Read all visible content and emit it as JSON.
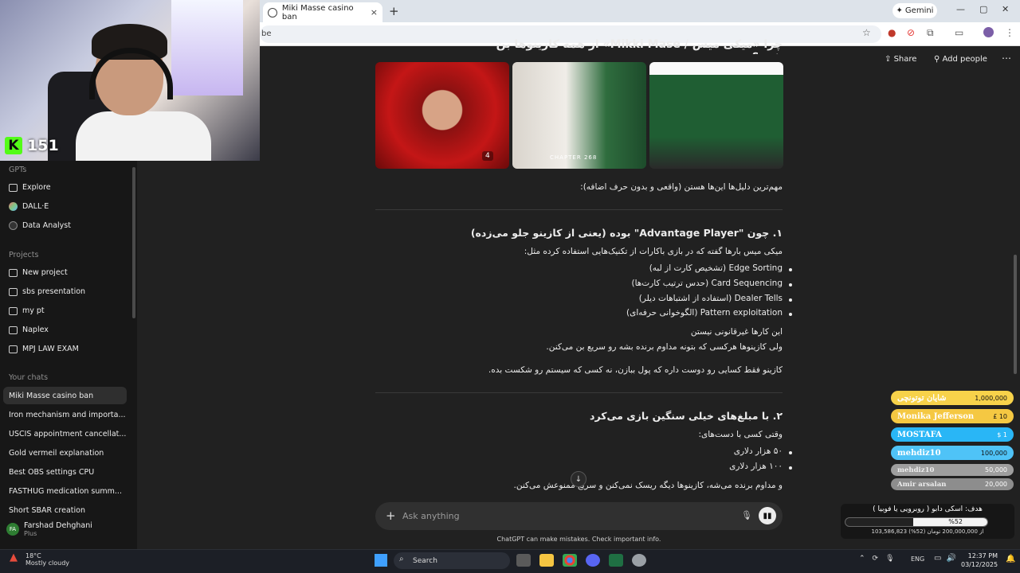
{
  "browser": {
    "tab_title": "Miki Masse casino ban",
    "tab_close": "×",
    "new_tab": "+",
    "gemini_label": "Gemini",
    "url_fragment": "be",
    "win_min": "—",
    "win_max": "▢",
    "win_close": "✕"
  },
  "stream": {
    "platform_badge": "K",
    "viewer_count": "151"
  },
  "sidebar": {
    "gpts_heading": "GPTs",
    "gpts": [
      {
        "label": "Explore",
        "icon": "grid-icon"
      },
      {
        "label": "DALL·E",
        "icon": "dalle-icon"
      },
      {
        "label": "Data Analyst",
        "icon": "data-analyst-icon"
      }
    ],
    "projects_heading": "Projects",
    "projects": [
      {
        "label": "New project"
      },
      {
        "label": "sbs presentation"
      },
      {
        "label": "my pt"
      },
      {
        "label": "Naplex"
      },
      {
        "label": "MPJ LAW EXAM"
      }
    ],
    "chats_heading": "Your chats",
    "chats": [
      "Miki Masse casino ban",
      "Iron mechanism and importa...",
      "USCIS appointment cancellat...",
      "Gold vermeil explanation",
      "Best OBS settings CPU",
      "FASTHUG medication summ...",
      "Short SBAR creation"
    ],
    "user": {
      "initials": "FA",
      "name": "Farshad Dehghani",
      "plan": "Plus"
    }
  },
  "header": {
    "share": "Share",
    "add_people": "Add people",
    "more": "⋯"
  },
  "content": {
    "top_heading": "چرا «میکی میس / Mikki Mase» از همه کازینوها بن شده؟",
    "image_count": "4",
    "chapter_text": "CHAPTER 268",
    "intro": "مهم‌ترین دلیل‌ها این‌ها هستن (واقعی و بدون حرف اضافه):",
    "section1_title": "۱. چون \"Advantage Player\" بوده (یعنی از کازینو جلو می‌زده)",
    "section1_lead": "میکی میس بارها گفته که در بازی باکارات از تکنیک‌هایی استفاده کرده مثل:",
    "section1_bullets": [
      "Edge Sorting (تشخیص کارت از لبه)",
      "Card Sequencing (حدس ترتیب کارت‌ها)",
      "Dealer Tells (استفاده از اشتباهات دیلر)",
      "Pattern exploitation (الگوخوانی حرفه‌ای)"
    ],
    "section1_p1": "این کارها غیرقانونی نیستن",
    "section1_p2": "ولی کازینوها هرکسی که بتونه مداوم برنده بشه رو سریع بن می‌کنن.",
    "section1_p3": "کازینو فقط کسایی رو دوست داره که پول ببازن، نه کسی که سیستم رو شکست بده.",
    "section2_title": "۲. با مبلغ‌های خیلی سنگین بازی می‌کرد",
    "section2_lead": "وقتی کسی با دست‌های:",
    "section2_bullets": [
      "۵۰ هزار دلاری",
      "۱۰۰ هزار دلاری"
    ],
    "section2_p1": "و مداوم برنده می‌شه، کازینوها دیگه ریسک نمی‌کنن و سریع ممنوعش می‌کنن."
  },
  "composer": {
    "placeholder": "Ask anything",
    "plus": "+",
    "disclaimer": "ChatGPT can make mistakes. Check important info."
  },
  "donations": [
    {
      "name": "شایان توتونچی",
      "amount": "1,000,000",
      "color": "#f7d24a"
    },
    {
      "name": "Monika Jefferson",
      "amount": "£ 10",
      "color": "#f5c842"
    },
    {
      "name": "MOSTAFA",
      "amount": "$ 1",
      "color": "#29b6f6"
    },
    {
      "name": "mehdiz10",
      "amount": "100,000",
      "color": "#4fc3f7"
    },
    {
      "name": "mehdiz10",
      "amount": "50,000",
      "color": "#9e9e9e"
    },
    {
      "name": "Amir arsalan",
      "amount": "20,000",
      "color": "#8d8d8d"
    }
  ],
  "goal": {
    "title": "هدف: اسکی دابو ( روبرویی یا فوبیا )",
    "percent_label": "%52",
    "percent": 52,
    "sub": "103,586,823 از 200,000,000 تومان (52%)"
  },
  "taskbar": {
    "temp": "18°C",
    "weather": "Mostly cloudy",
    "search": "Search",
    "lang": "ENG",
    "time": "12:37 PM",
    "date": "03/12/2025"
  }
}
